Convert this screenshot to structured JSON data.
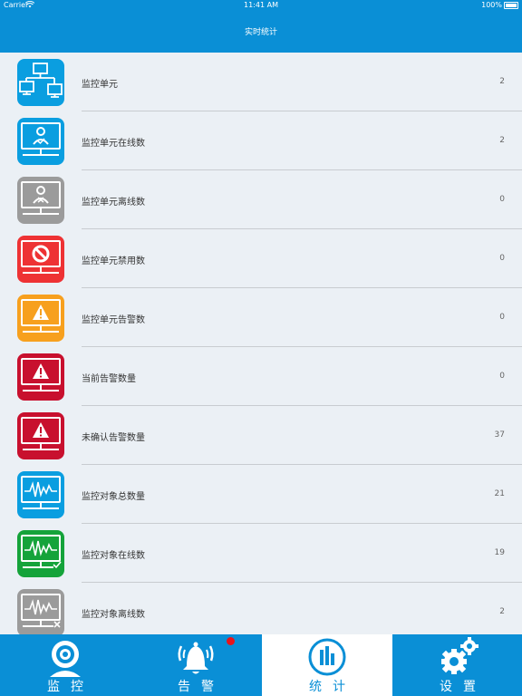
{
  "status": {
    "carrier": "Carrier",
    "time": "11:41 AM",
    "battery": "100%"
  },
  "header": {
    "title": "实时统计"
  },
  "colors": {
    "header_blue": "#0a8fd6",
    "icon_blue": "#0a9ee0",
    "icon_gray": "#9b9b9b",
    "icon_red": "#ee3234",
    "icon_orange": "#f7a01e",
    "icon_crimson": "#c8102e",
    "icon_green": "#15a33a"
  },
  "stats": [
    {
      "label": "监控单元",
      "value": "2",
      "icon": "network-topology-icon",
      "color": "#0a9ee0"
    },
    {
      "label": "监控单元在线数",
      "value": "2",
      "icon": "monitor-user-online-icon",
      "color": "#0a9ee0"
    },
    {
      "label": "监控单元离线数",
      "value": "0",
      "icon": "monitor-user-offline-icon",
      "color": "#9b9b9b"
    },
    {
      "label": "监控单元禁用数",
      "value": "0",
      "icon": "monitor-disabled-icon",
      "color": "#ee3234"
    },
    {
      "label": "监控单元告警数",
      "value": "0",
      "icon": "monitor-warning-icon",
      "color": "#f7a01e"
    },
    {
      "label": "当前告警数量",
      "value": "0",
      "icon": "monitor-current-alarm-icon",
      "color": "#c8102e"
    },
    {
      "label": "未确认告警数量",
      "value": "37",
      "icon": "monitor-unconfirmed-alarm-icon",
      "color": "#c8102e"
    },
    {
      "label": "监控对象总数量",
      "value": "21",
      "icon": "monitor-waveform-icon",
      "color": "#0a9ee0"
    },
    {
      "label": "监控对象在线数",
      "value": "19",
      "icon": "monitor-waveform-online-icon",
      "color": "#15a33a"
    },
    {
      "label": "监控对象离线数",
      "value": "2",
      "icon": "monitor-waveform-offline-icon",
      "color": "#9b9b9b"
    }
  ],
  "tabs": [
    {
      "label": "监控",
      "icon": "webcam-icon",
      "active": false
    },
    {
      "label": "告警",
      "icon": "alarm-bell-icon",
      "active": false,
      "badge": true
    },
    {
      "label": "统计",
      "icon": "statistics-bars-icon",
      "active": true
    },
    {
      "label": "设置",
      "icon": "gears-icon",
      "active": false
    }
  ]
}
